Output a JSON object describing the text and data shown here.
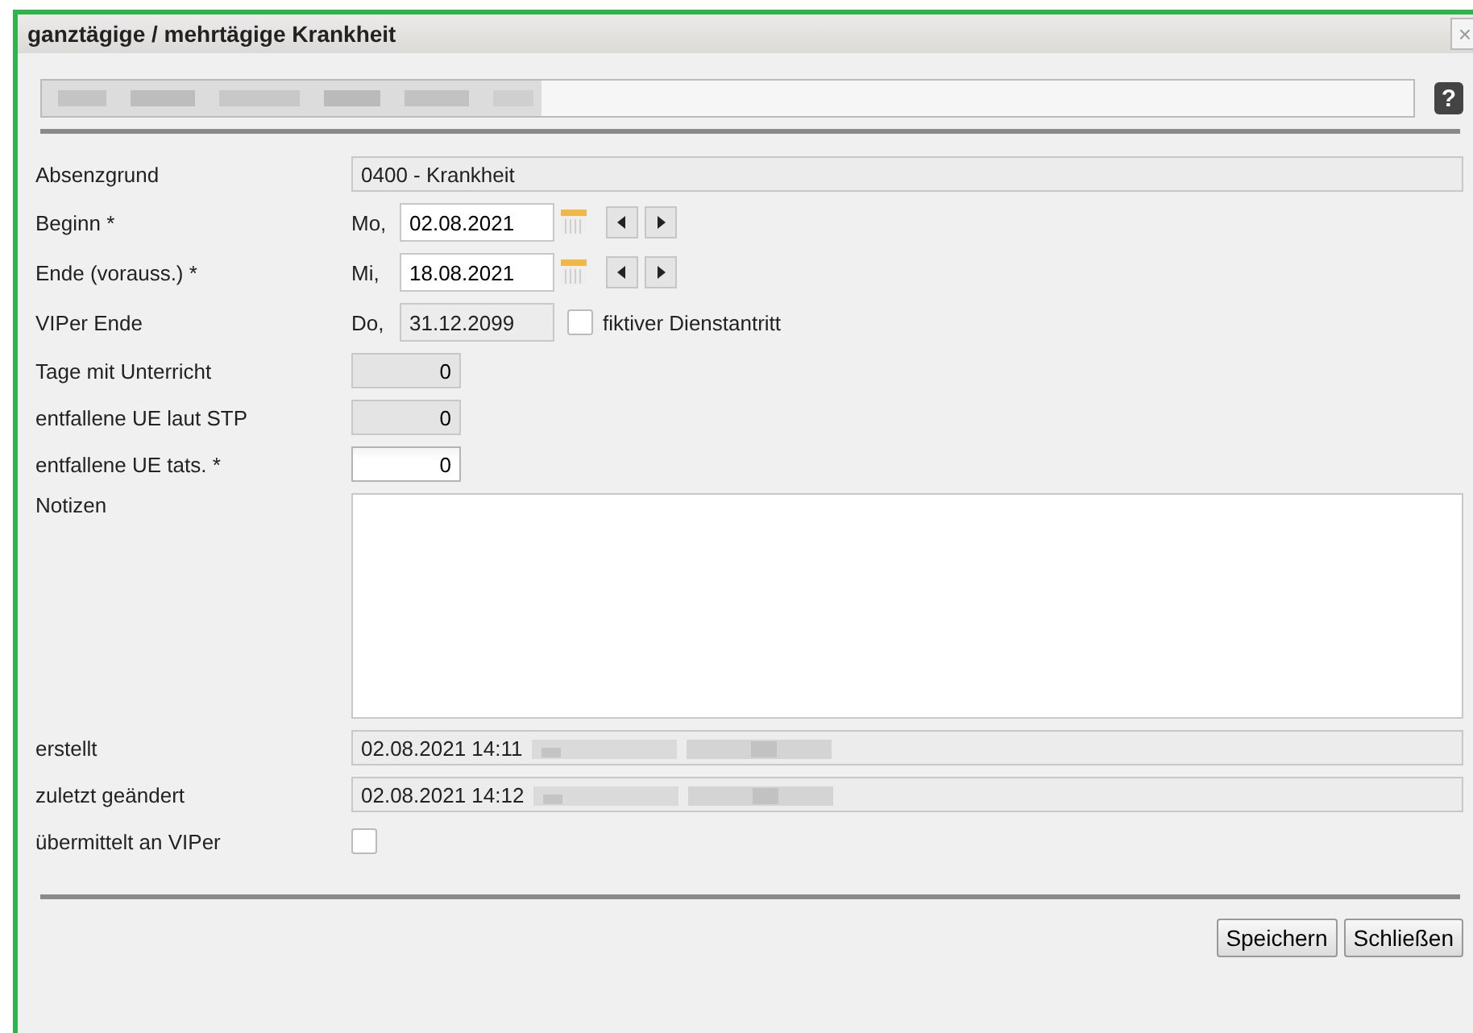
{
  "window": {
    "title": "ganztägige / mehrtägige Krankheit",
    "close": "×"
  },
  "help": "?",
  "fields": [
    {
      "kind": "text",
      "label": "Absenzgrund",
      "value": "0400 - Krankheit"
    },
    {
      "kind": "date",
      "label": "Beginn *",
      "weekday": "Mo,",
      "value": "02.08.2021",
      "editable": true
    },
    {
      "kind": "date",
      "label": "Ende (vorauss.) *",
      "weekday": "Mi,",
      "value": "18.08.2021",
      "editable": true
    },
    {
      "kind": "viper",
      "label": "VIPer Ende",
      "weekday": "Do,",
      "value": "31.12.2099",
      "checkbox_label": "fiktiver Dienstantritt",
      "checked": false
    },
    {
      "kind": "number",
      "label": "Tage mit Unterricht",
      "value": "0",
      "editable": false
    },
    {
      "kind": "number",
      "label": "entfallene UE laut STP",
      "value": "0",
      "editable": false
    },
    {
      "kind": "number",
      "label": "entfallene UE tats. *",
      "value": "0",
      "editable": true
    },
    {
      "kind": "notes",
      "label": "Notizen"
    },
    {
      "kind": "stamp",
      "label": "erstellt",
      "value": "02.08.2021 14:11"
    },
    {
      "kind": "stamp",
      "label": "zuletzt geändert",
      "value": "02.08.2021 14:12"
    },
    {
      "kind": "check",
      "label": "übermittelt an VIPer",
      "checked": false
    }
  ],
  "buttons": [
    "Speichern",
    "Schließen"
  ]
}
